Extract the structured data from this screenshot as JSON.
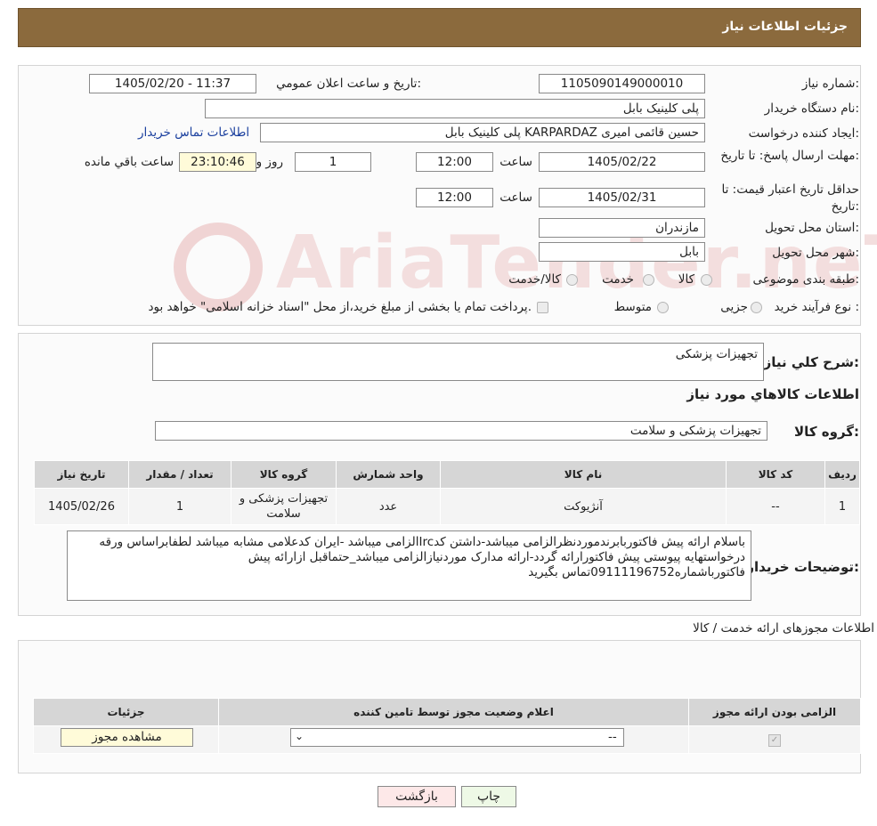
{
  "header": {
    "title": "جزئیات اطلاعات نیاز"
  },
  "watermark": {
    "text": "AriaTender.neT"
  },
  "details": {
    "need_number_label": "شماره نیاز:",
    "need_number": "1105090149000010",
    "announce_label": "تاریخ و ساعت اعلان عمومي:",
    "announce_value": "1405/02/20 - 11:37",
    "buyer_org_label": "نام دستگاه خریدار:",
    "buyer_org": "پلی کلینیک بابل",
    "creator_label": "ایجاد کننده درخواست:",
    "creator": "حسین قائمی امیری KARPARDAZ پلی کلینیک بابل",
    "contact_link": "اطلاعات تماس خریدار",
    "deadline_label": "مهلت ارسال پاسخ: تا تاریخ:",
    "deadline_date": "1405/02/22",
    "time_label": "ساعت",
    "deadline_time": "12:00",
    "days_count": "1",
    "days_label": "روز و",
    "remaining_time": "23:10:46",
    "remaining_label": "ساعت باقي مانده",
    "validity_label": "حداقل تاریخ اعتبار قیمت: تا تاریخ:",
    "validity_date": "1405/02/31",
    "validity_time": "12:00",
    "province_label": "استان محل تحویل:",
    "province": "مازندران",
    "city_label": "شهر محل تحویل:",
    "city": "بابل",
    "category_label": "طبقه بندی موضوعی:",
    "category_options": [
      "کالا",
      "خدمت",
      "کالا/خدمت"
    ],
    "process_label": "نوع فرآیند خرید :",
    "process_options": [
      "جزیی",
      "متوسط"
    ],
    "process_note": "پرداخت تمام یا بخشی از مبلغ خرید،از محل \"اسناد خزانه اسلامی\" خواهد بود."
  },
  "summary": {
    "desc_label": "شرح کلي نیاز:",
    "desc_value": "تجهیزات پزشکی",
    "goods_info_title": "اطلاعات کالاهاي مورد نیاز",
    "goods_group_label": "گروه کالا:",
    "goods_group_value": "تجهیزات پزشکی و سلامت"
  },
  "goods_table": {
    "headers": [
      "ردیف",
      "کد کالا",
      "نام کالا",
      "واحد شمارش",
      "گروه کالا",
      "تعداد / مقدار",
      "تاریخ نیاز"
    ],
    "rows": [
      [
        "1",
        "--",
        "آنژیوکت",
        "عدد",
        "تجهیزات پزشکی و سلامت",
        "1",
        "1405/02/26"
      ]
    ]
  },
  "buyer_notes": {
    "label": "توضیحات خریدار:",
    "text": "باسلام ارائه پیش فاکتوربابرندموردنظرالزامی میباشد-داشتن کدIrcالزامی میباشد -ایران کدعلامی مشابه میباشد لطفابراساس ورقه درخواستهایه پیوستی پیش فاکتورارائه گردد-ارائه مدارک موردنیازالزامی میباشد_حتماقبل ازارائه پیش فاکتورباشماره09111196752تماس بگیرید"
  },
  "licenses": {
    "section_title": "اطلاعات مجوزهای ارائه خدمت / کالا",
    "headers": [
      "الزامی بودن ارائه مجوز",
      "اعلام وضعیت مجوز توسط تامین کننده",
      "جزئیات"
    ],
    "select_value": "--",
    "view_button": "مشاهده مجوز"
  },
  "actions": {
    "print": "چاپ",
    "back": "بازگشت"
  }
}
